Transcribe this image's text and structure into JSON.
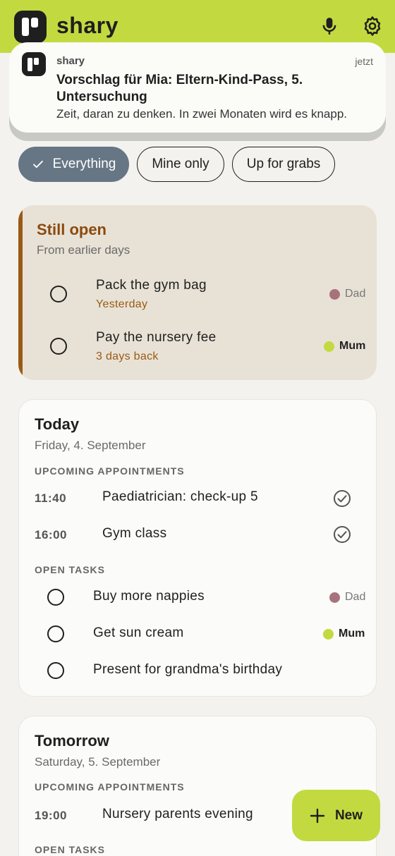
{
  "app": {
    "name": "shary"
  },
  "notification": {
    "app": "shary",
    "time": "jetzt",
    "title": "Vorschlag für Mia: Eltern-Kind-Pass, 5. Untersuchung",
    "body": "Zeit, daran zu denken. In zwei Monaten wird es knapp."
  },
  "filters": [
    {
      "label": "Everything",
      "selected": true
    },
    {
      "label": "Mine only",
      "selected": false
    },
    {
      "label": "Up for grabs",
      "selected": false
    }
  ],
  "still_open": {
    "title": "Still open",
    "subtitle": "From earlier days",
    "tasks": [
      {
        "name": "Pack the gym bag",
        "when": "Yesterday",
        "assignee": "Dad"
      },
      {
        "name": "Pay the nursery fee",
        "when": "3 days back",
        "assignee": "Mum"
      }
    ]
  },
  "today": {
    "title": "Today",
    "date": "Friday, 4. September",
    "appointments_label": "UPCOMING APPOINTMENTS",
    "appointments": [
      {
        "time": "11:40",
        "name": "Paediatrician: check-up 5"
      },
      {
        "time": "16:00",
        "name": "Gym class"
      }
    ],
    "tasks_label": "OPEN TASKS",
    "tasks": [
      {
        "name": "Buy more nappies",
        "assignee": "Dad"
      },
      {
        "name": "Get sun cream",
        "assignee": "Mum"
      },
      {
        "name": "Present for grandma's birthday",
        "assignee": ""
      }
    ]
  },
  "tomorrow": {
    "title": "Tomorrow",
    "date": "Saturday, 5. September",
    "appointments_label": "UPCOMING APPOINTMENTS",
    "appointments": [
      {
        "time": "19:00",
        "name": "Nursery parents evening"
      }
    ],
    "tasks_label": "OPEN TASKS"
  },
  "fab": {
    "label": "New"
  },
  "colors": {
    "brand": "#c2da3f",
    "chip_selected": "#677684",
    "overdue_accent": "#9a5a14",
    "dad": "#a8727c",
    "mum": "#c2da3f"
  }
}
